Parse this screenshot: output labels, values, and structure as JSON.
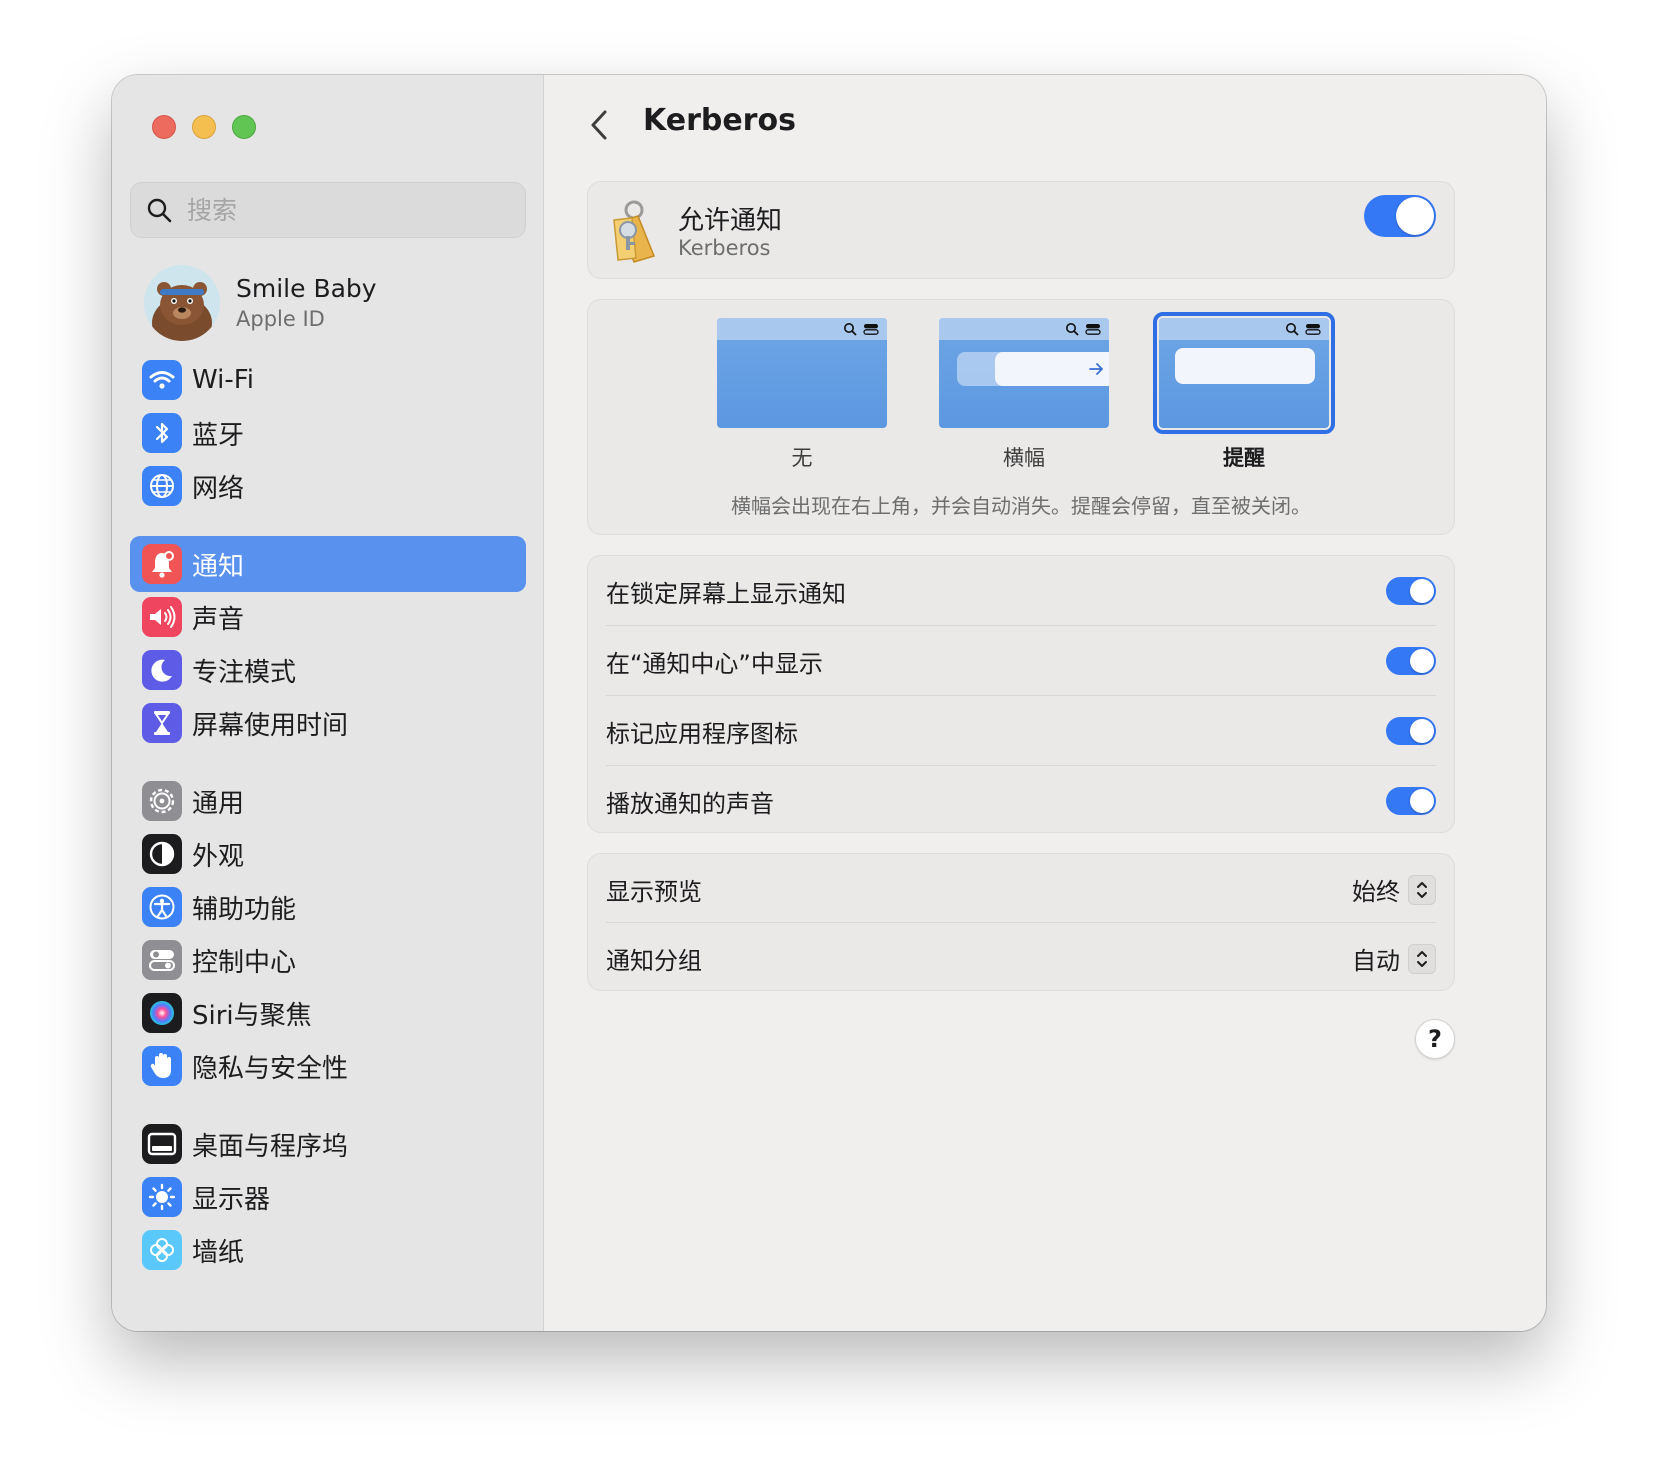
{
  "window": {
    "traffic_lights": [
      "close",
      "minimize",
      "zoom"
    ]
  },
  "sidebar": {
    "search": {
      "placeholder": "搜索",
      "value": ""
    },
    "profile": {
      "name": "Smile Baby",
      "subtitle": "Apple ID"
    },
    "items": [
      {
        "label": "Wi-Fi",
        "icon": "wifi-icon",
        "color": "#3b82f6"
      },
      {
        "label": "蓝牙",
        "icon": "bluetooth-icon",
        "color": "#3b82f6"
      },
      {
        "label": "网络",
        "icon": "globe-icon",
        "color": "#3b82f6"
      },
      {
        "label": "通知",
        "icon": "bell-icon",
        "color": "#f05454",
        "selected": true
      },
      {
        "label": "声音",
        "icon": "speaker-icon",
        "color": "#f0455f"
      },
      {
        "label": "专注模式",
        "icon": "moon-icon",
        "color": "#5e5ce6"
      },
      {
        "label": "屏幕使用时间",
        "icon": "hourglass-icon",
        "color": "#5e5ce6"
      },
      {
        "label": "通用",
        "icon": "gear-icon",
        "color": "#8e8e93"
      },
      {
        "label": "外观",
        "icon": "appearance-icon",
        "color": "#1c1c1e"
      },
      {
        "label": "辅助功能",
        "icon": "accessibility-icon",
        "color": "#3b82f6"
      },
      {
        "label": "控制中心",
        "icon": "control-center-icon",
        "color": "#8e8e93"
      },
      {
        "label": "Siri与聚焦",
        "icon": "siri-icon",
        "color": "#1c1c1e"
      },
      {
        "label": "隐私与安全性",
        "icon": "hand-icon",
        "color": "#3b82f6"
      },
      {
        "label": "桌面与程序坞",
        "icon": "dock-icon",
        "color": "#1c1c1e"
      },
      {
        "label": "显示器",
        "icon": "sun-icon",
        "color": "#3b82f6"
      },
      {
        "label": "墙纸",
        "icon": "flower-icon",
        "color": "#5ac8fa"
      }
    ]
  },
  "main": {
    "title": "Kerberos",
    "allow": {
      "title": "允许通知",
      "subtitle": "Kerberos",
      "enabled": true
    },
    "styles": {
      "options": [
        {
          "label": "无"
        },
        {
          "label": "横幅"
        },
        {
          "label": "提醒",
          "selected": true
        }
      ],
      "description": "横幅会出现在右上角，并会自动消失。提醒会停留，直至被关闭。"
    },
    "toggles": [
      {
        "label": "在锁定屏幕上显示通知",
        "on": true
      },
      {
        "label": "在“通知中心”中显示",
        "on": true
      },
      {
        "label": "标记应用程序图标",
        "on": true
      },
      {
        "label": "播放通知的声音",
        "on": true
      }
    ],
    "popups": [
      {
        "label": "显示预览",
        "value": "始终"
      },
      {
        "label": "通知分组",
        "value": "自动"
      }
    ],
    "help": "?"
  },
  "colors": {
    "accent": "#3478f6",
    "selection": "#5891ee"
  }
}
